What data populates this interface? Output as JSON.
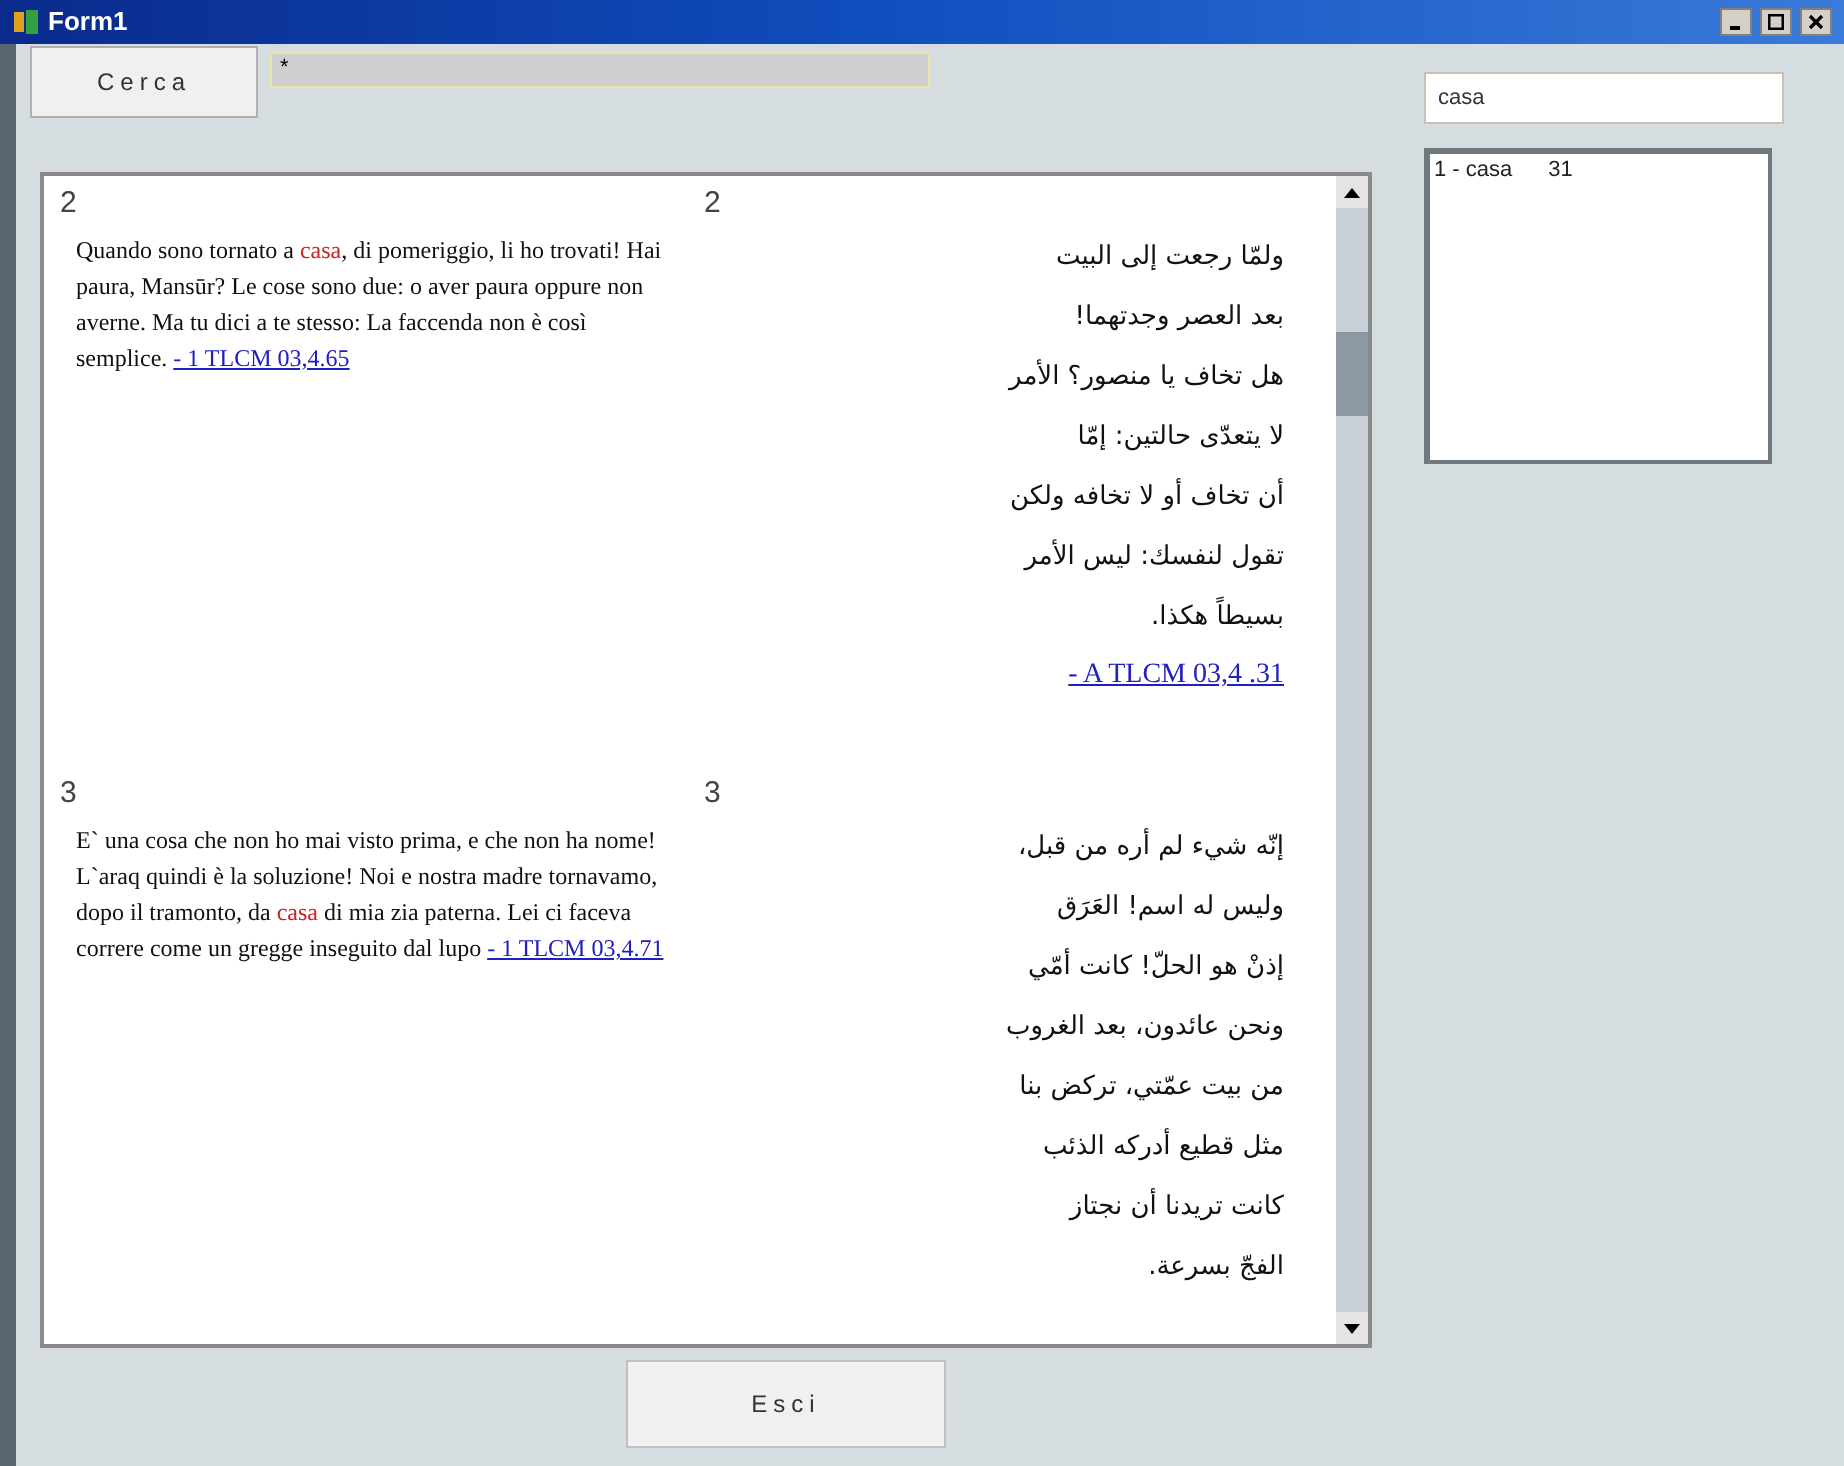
{
  "window": {
    "title": "Form1"
  },
  "toolbar": {
    "search_button": "Cerca",
    "pattern_field": {
      "value": "*"
    }
  },
  "passages": [
    {
      "left_number": "2",
      "right_number": "2",
      "italian": "Quando sono tornato a **casa**, di pomeriggio, li ho trovati! Hai paura, Mansūr? Le cose sono due: o aver paura oppure non averne. Ma tu dici a te stesso: La faccenda non è così semplice.",
      "italian_ref": "- 1 TLCM 03,4.65",
      "arabic_lines": [
        "ولمّا رجعت إلى البيت",
        "بعد العصر وجدتهما!",
        "هل تخاف يا منصور؟ الأمر",
        "لا يتعدّى حالتين: إمّا",
        "أن تخاف أو لا تخافه ولكن",
        "تقول لنفسك: ليس الأمر",
        "بسيطاً هكذا."
      ],
      "arabic_ref": "- A TLCM 03,4 .31"
    },
    {
      "left_number": "3",
      "right_number": "3",
      "italian": "E` una cosa che non ho mai visto prima, e che non ha nome! L`araq quindi è la soluzione! Noi e nostra madre tornavamo, dopo il tramonto, da **casa** di mia zia paterna. Lei ci faceva correre come un gregge inseguito dal lupo",
      "italian_ref": "- 1 TLCM 03,4.71",
      "arabic_lines": [
        "إنّه شيء لم أره من قبل،",
        "وليس له اسم! العَرَق",
        "إذنْ هو الحلّ! كانت أمّي",
        "ونحن عائدون، بعد الغروب",
        "من بيت عمّتي، تركض بنا",
        "مثل قطيع أدركه الذئب",
        "كانت تريدنا أن نجتاز",
        "الفجّ بسرعة."
      ]
    }
  ],
  "word_field": {
    "value": "casa"
  },
  "results": [
    {
      "label": "1 - casa",
      "count": "31"
    }
  ],
  "exit_button": "Esci"
}
